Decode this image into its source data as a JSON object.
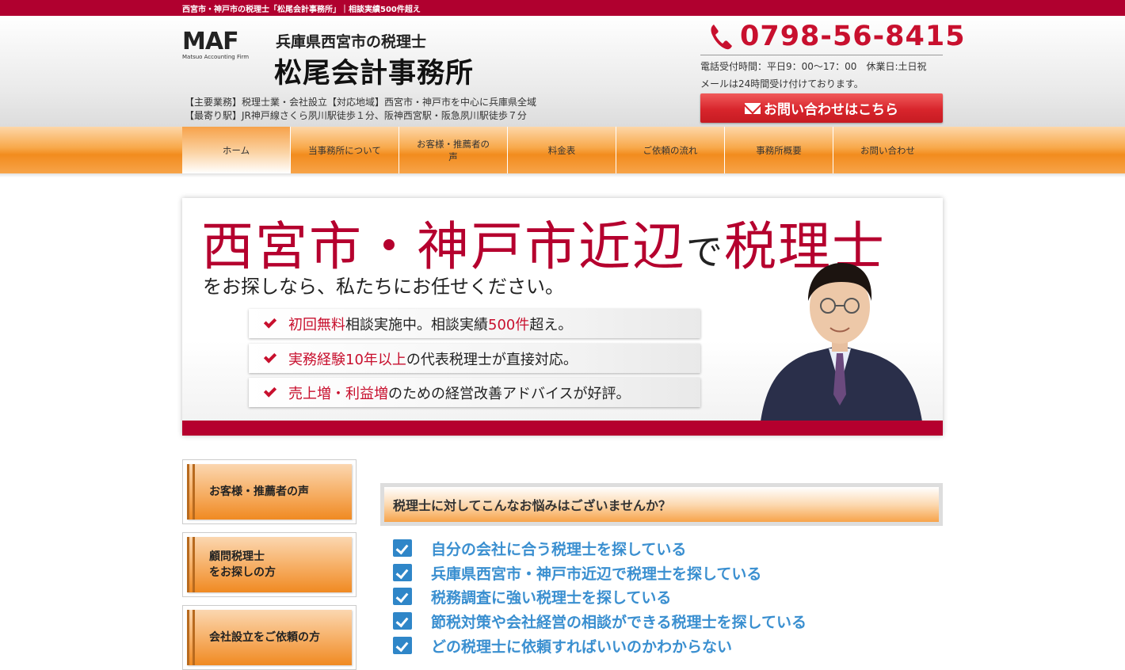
{
  "top_strip": {
    "text": "西宮市・神戸市の税理士「松尾会計事務所」｜相談実績500件超え"
  },
  "header": {
    "logo_mark": "MAF",
    "logo_caption": "Matsuo Accounting Firm",
    "site_subtitle": "兵庫県西宮市の税理士",
    "site_title": "松尾会計事務所",
    "info_line1": "【主要業務】税理士業・会社設立【対応地域】西宮市・神戸市を中心に兵庫県全域",
    "info_line2": "【最寄り駅】JR神戸線さくら夙川駅徒歩１分、阪神西宮駅・阪急夙川駅徒歩７分",
    "phone": "0798-56-8415",
    "hours": "電話受付時間：平日9：00〜17：00　休業日:土日祝",
    "mail_note": "メールは24時間受け付けております。",
    "contact_button": "お問い合わせはこちら",
    "accent_color": "#b5002e"
  },
  "nav": {
    "items": [
      {
        "label": "ホーム"
      },
      {
        "label": "当事務所について"
      },
      {
        "label": "お客様・推薦者の声"
      },
      {
        "label": "料金表"
      },
      {
        "label": "ご依頼の流れ"
      },
      {
        "label": "事務所概要"
      },
      {
        "label": "お問い合わせ"
      }
    ],
    "active_index": 0
  },
  "hero": {
    "title_part1": "西宮市・神戸市近辺",
    "title_de": "で",
    "title_part2": "税理士",
    "subtitle": "をお探しなら、私たちにお任せください。",
    "points": [
      {
        "hl1": "初回無料",
        "t1": "相談実施中。相談実績",
        "hl2": "500件",
        "t2": "超え。"
      },
      {
        "hl1": "実務経験10年以上",
        "t1": "の代表税理士が直接対応。",
        "hl2": "",
        "t2": ""
      },
      {
        "hl1": "売上増・利益増",
        "t1": "のための経営改善アドバイスが好評。",
        "hl2": "",
        "t2": ""
      }
    ]
  },
  "sidebar": {
    "items": [
      {
        "label": "お客様・推薦者の声"
      },
      {
        "label_line1": "顧問税理士",
        "label_line2": "をお探しの方"
      },
      {
        "label": "会社設立をご依頼の方"
      }
    ]
  },
  "main": {
    "concern_heading": "税理士に対してこんなお悩みはございませんか？",
    "concerns": [
      "自分の会社に合う税理士を探している",
      "兵庫県西宮市・神戸市近辺で税理士を探している",
      "税務調査に強い税理士を探している",
      "節税対策や会社経営の相談ができる税理士を探している",
      "どの税理士に依頼すればいいのかわからない"
    ]
  }
}
